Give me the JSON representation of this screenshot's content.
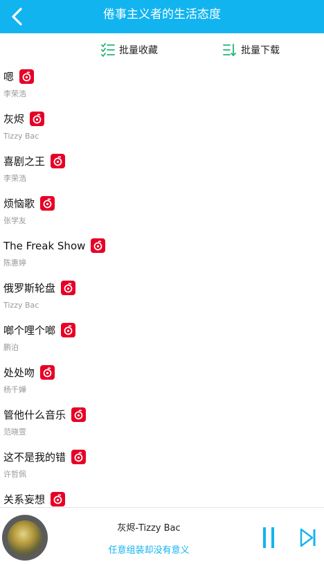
{
  "header": {
    "title": "倦事主义者的生活态度"
  },
  "actions": {
    "collect_label": "批量收藏",
    "download_label": "批量下载"
  },
  "songs": [
    {
      "title": "嗯",
      "artist": "李荣浩"
    },
    {
      "title": "灰烬",
      "artist": "Tizzy Bac"
    },
    {
      "title": "喜剧之王",
      "artist": "李荣浩"
    },
    {
      "title": "烦恼歌",
      "artist": "张学友"
    },
    {
      "title": "The Freak Show",
      "artist": "陈惠婷"
    },
    {
      "title": "俄罗斯轮盘",
      "artist": "Tizzy Bac"
    },
    {
      "title": "啷个哩个啷",
      "artist": "鹏泊"
    },
    {
      "title": "处处吻",
      "artist": "杨千嬅"
    },
    {
      "title": "管他什么音乐",
      "artist": "范晓萱"
    },
    {
      "title": "这不是我的错",
      "artist": "许哲佩"
    },
    {
      "title": "关系妄想",
      "artist": ""
    }
  ],
  "player": {
    "now_playing": "灰烬-Tizzy Bac",
    "subtitle": "任意组装却没有意义"
  },
  "colors": {
    "accent": "#12b4f0",
    "badge": "#e60026"
  }
}
